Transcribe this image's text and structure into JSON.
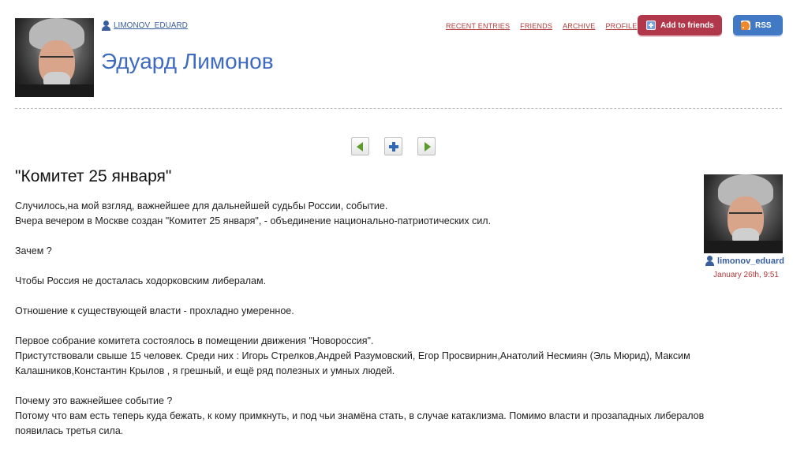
{
  "header": {
    "username": "LIMONOV_EDUARD",
    "journal_title": "Эдуард Лимонов",
    "nav": [
      "RECENT ENTRIES",
      "FRIENDS",
      "ARCHIVE",
      "PROFILE"
    ],
    "add_friends_label": "Add to friends",
    "rss_label": "RSS",
    "colors": {
      "add_button": "#b0384a",
      "rss_button": "#4179c4",
      "title": "#3f6bbf",
      "nav_link": "#b33a3a"
    }
  },
  "entry_nav": {
    "prev_icon": "arrow-left-icon",
    "add_icon": "plus-icon",
    "next_icon": "arrow-right-icon"
  },
  "entry": {
    "title": "\"Комитет 25 января\"",
    "paragraphs": [
      "Случилось,на мой взгляд, важнейшее для дальнейшей судьбы России, событие.",
      "Вчера вечером в Москве создан \"Комитет 25 января\", - объединение национально-патриотических сил.",
      "",
      "Зачем ?",
      "",
      "Чтобы Россия не досталась ходорковским либералам.",
      "",
      "Отношение к существующей власти - прохладно умеренное.",
      "",
      "Первое собрание комитета состоялось в помещении движения \"Новороссия\".",
      "Приcтутствовали свыше 15 человек. Среди них : Игорь Стрелков,Андрей Разумовский, Егор Просвирнин,Анатолий Несмиян (Эль Мюрид), Максим Калашников,Константин Крылов , я грешный, и ещё ряд полезных и умных людей.",
      "",
      "Почему это важнейшее событие ?",
      "Потому что вам есть теперь куда бежать, к кому примкнуть, и под чьи знамёна стать, в случае катаклизма. Помимо власти и прозападных либералов появилась третья сила."
    ],
    "poster": {
      "username": "limonov_eduard",
      "date": "January 26th, 9:51"
    }
  }
}
